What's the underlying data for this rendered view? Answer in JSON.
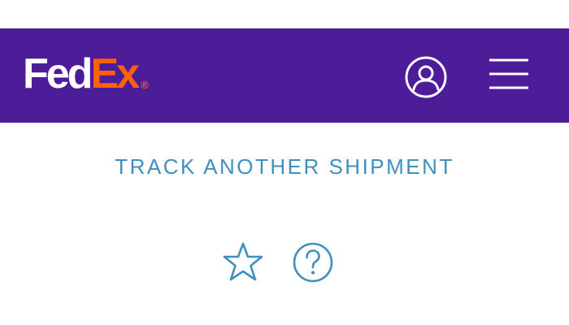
{
  "header": {
    "logo": {
      "part1": "Fed",
      "part2": "Ex",
      "registered_mark": "®"
    },
    "account_icon": "user-account-icon",
    "menu_icon": "hamburger-menu-icon"
  },
  "main": {
    "track_link_label": "TRACK ANOTHER SHIPMENT",
    "favorite_icon": "star-icon",
    "help_icon": "question-mark-icon"
  },
  "colors": {
    "header_background": "#4d1d99",
    "logo_fed": "#ffffff",
    "logo_ex": "#ff6200",
    "link": "#3f8fbf"
  }
}
